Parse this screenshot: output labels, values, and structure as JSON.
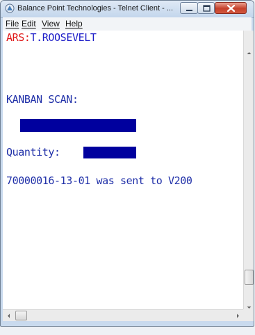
{
  "window": {
    "title": "Balance Point Technologies - Telnet Client - ...",
    "icons": {
      "app": "telnet-app-icon",
      "minimize": "minimize-icon",
      "maximize": "maximize-icon",
      "close": "close-icon"
    }
  },
  "menu": {
    "file": "File",
    "edit": "Edit",
    "view": "View",
    "help": "Help"
  },
  "terminal": {
    "user_prefix": "ARS:",
    "user_name": "T.ROOSEVELT",
    "scan_label": "KANBAN SCAN:",
    "quantity_label": "Quantity:",
    "message": "70000016-13-01 was sent to V200",
    "colors": {
      "text": "#1f2fa8",
      "prefix": "#e01818",
      "field": "#00009e",
      "background": "#ffffff"
    }
  }
}
